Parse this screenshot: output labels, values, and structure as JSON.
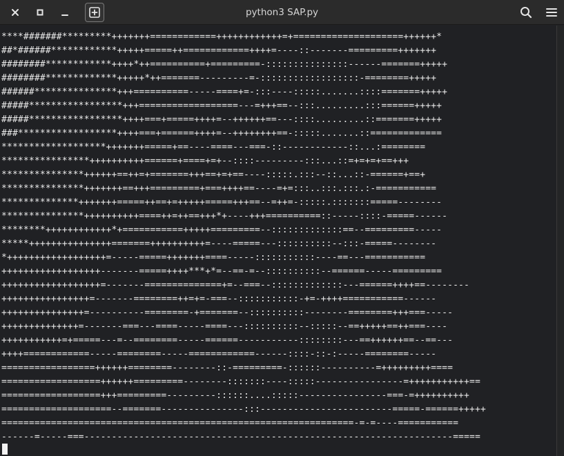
{
  "window": {
    "title": "python3 SAP.py"
  },
  "titlebar": {
    "close_icon": "close-icon",
    "maximize_icon": "maximize-icon",
    "minimize_icon": "minimize-icon",
    "new_tab_icon": "new-tab-icon",
    "search_icon": "search-icon",
    "menu_icon": "hamburger-menu-icon"
  },
  "terminal": {
    "output": "****#######*********+++++++============++++++++++++=+====================++++++*\n##*######************+++++=====++============++++=----::-------=========+++++++\n########************++++*++==========+=========-:::::::::::::::------=======+++++\n########*************+++++*++=======---------=-::::::::::::::::::-========+++++\n######***************+++==========-----====+=-:::----:::::.......::::=======+++++\n#####*****************+++==================---=+++==--:::.........:::======+++++\n#####*****************++++===+=====++++=--++++++==---::::.........::=======+++++\n###******************++++===+======++++=--++++++++==-:::::.......::=============\n*******************+++++++=====+==----====---===-::------------::...:========\n****************++++++++++======+====+=+--::::---------:::...::=+=+=+==+++\n***************++++++==++=+=======+++==+=+==----:::::.:::--::...::-======+==+\n***************+++++++==+++=========+===++++==----=+=:::..:::.:::.:-===========\n**************+++++++=====++==+=+++++=====+++==--=++=-:::::.:::::::=====--------\n***************++++++++++====++=++==+++*+----+++==========::-----::::-=====------\n********++++++++++++*+===========+++++=========--:::::::::::::==--=========-----\n*****+++++++++++++++=======++++++++++=----=====---::::::::::--:::-=====--------\n*++++++++++++++++++=-----=====+++++++====-----:::::::::::----==---===========\n++++++++++++++++++-------=====++++***+*=--==-=--::::::::::--======-----=========\n++++++++++++++++++=-------==============+=--===--:::::::::::::---======++++==--------\n++++++++++++++++=-------========++=+=-===--:::::::::::-+=-++++===========------\n+++++++++++++++=----------========-+=======--::::::::::--------========+++===-----\n++++++++++++++=-------===---====-----====---::::::::::--:::::--==+++++==++===----\n+++++++++++=+=====---=--========-----======-----------::::::::---==++++++==--==---\n++++============-----========-----============------::::-::-:-----========-----\n=================++++++========--------::-=========-::::::----------=+++++++++====\n==================++++++=========--------:::::::----:::::----------------=+++++++++++==\n==================+++=========---------::::::....:::::----------------===-=++++++++++\n====================--=======---------------:::------------------------=====-======+++++\n================================================================-=-=----===========\n------=-----===-------------------------------------------------------------------====="
  }
}
